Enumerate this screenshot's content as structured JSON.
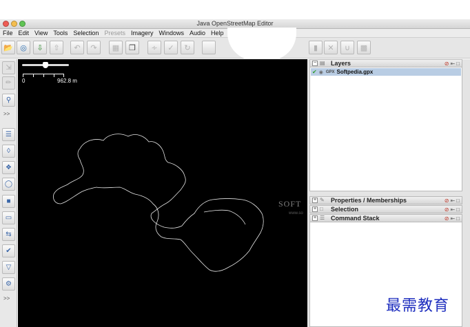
{
  "window": {
    "title": "Java OpenStreetMap Editor"
  },
  "menu": [
    {
      "label": "File",
      "enabled": true
    },
    {
      "label": "Edit",
      "enabled": true
    },
    {
      "label": "View",
      "enabled": true
    },
    {
      "label": "Tools",
      "enabled": true
    },
    {
      "label": "Selection",
      "enabled": true
    },
    {
      "label": "Presets",
      "enabled": false
    },
    {
      "label": "Imagery",
      "enabled": true
    },
    {
      "label": "Windows",
      "enabled": true
    },
    {
      "label": "Audio",
      "enabled": true
    },
    {
      "label": "Help",
      "enabled": true
    }
  ],
  "toolbar": {
    "icons": [
      "open-file-icon",
      "open-location-icon",
      "save-icon",
      "upload-icon",
      "undo-icon",
      "redo-icon",
      "preferences-icon",
      "copy-icon",
      "wireframe-icon",
      "validation-icon",
      "refresh-icon",
      "blank-icon",
      "split-icon",
      "delete-icon",
      "lock-icon",
      "audio-icon"
    ]
  },
  "left_tools": {
    "expand_label": ">>",
    "icons": [
      "select-icon",
      "draw-icon",
      "zoom-icon",
      "layer-list-icon",
      "tag-icon",
      "relation-icon",
      "history-icon",
      "conflict-icon",
      "note-icon",
      "reverse-icon",
      "validate-check-icon",
      "filter-icon",
      "settings-gear-icon"
    ]
  },
  "map": {
    "scale_start": "0",
    "scale_end": "962.8 m",
    "watermark": "SOFT",
    "watermark_sub": "www.so"
  },
  "panels": {
    "layers": {
      "title": "Layers",
      "rows": [
        {
          "type": "GPX",
          "name": "Softpedia.gpx"
        }
      ]
    },
    "properties": {
      "title": "Properties / Memberships"
    },
    "selection": {
      "title": "Selection"
    },
    "command_stack": {
      "title": "Command Stack"
    }
  },
  "corner_watermark": "最需教育",
  "colors": {
    "map_background": "#000000",
    "selection_row": "#b9cde4",
    "track": "#e8e8e8"
  }
}
